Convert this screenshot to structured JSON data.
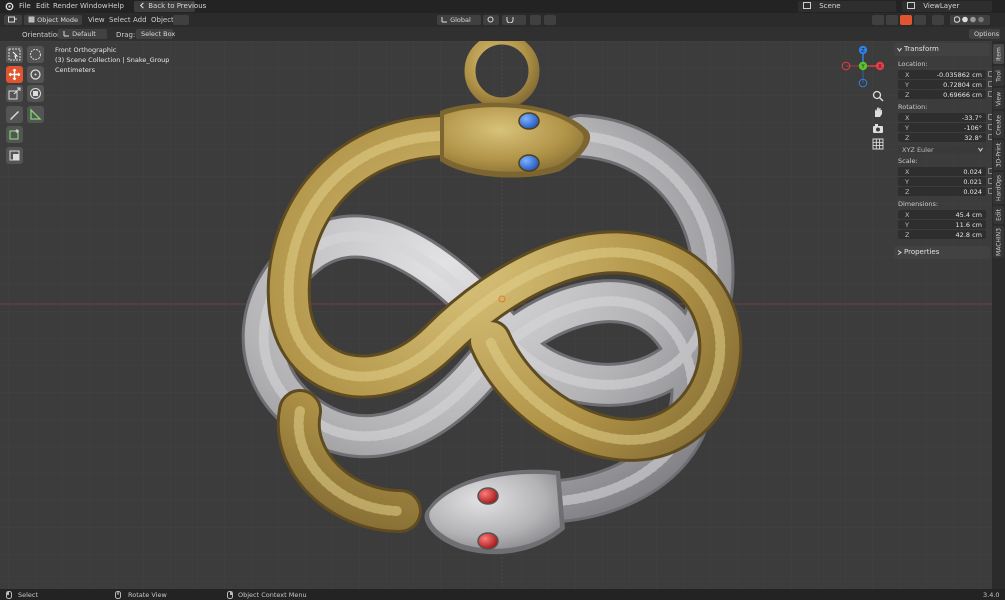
{
  "menu": {
    "file": "File",
    "edit": "Edit",
    "render": "Render",
    "window": "Window",
    "help": "Help",
    "back_button": "Back to Previous"
  },
  "scene": {
    "label": "Scene",
    "view_layer": "ViewLayer"
  },
  "header": {
    "mode": "Object Mode",
    "view": "View",
    "select": "Select",
    "add": "Add",
    "object": "Object",
    "transform_orientation": "Global",
    "options": "Options"
  },
  "tool_settings": {
    "orientation_label": "Orientation:",
    "orientation_value": "Default",
    "drag_label": "Drag:",
    "drag_value": "Select Box"
  },
  "viewport_info": {
    "view_name": "Front Orthographic",
    "collection": "(3) Scene Collection | Snake_Group",
    "units": "Centimeters"
  },
  "gizmo": {
    "x": "X",
    "y": "Y",
    "z": "Z"
  },
  "transform_panel": {
    "title": "Transform",
    "location_label": "Location:",
    "location": [
      {
        "axis": "X",
        "value": "-0.035862 cm"
      },
      {
        "axis": "Y",
        "value": "0.72804 cm"
      },
      {
        "axis": "Z",
        "value": "0.69666 cm"
      }
    ],
    "rotation_label": "Rotation:",
    "rotation": [
      {
        "axis": "X",
        "value": "-33.7°"
      },
      {
        "axis": "Y",
        "value": "-106°"
      },
      {
        "axis": "Z",
        "value": "32.8°"
      }
    ],
    "rotation_mode": "XYZ Euler",
    "scale_label": "Scale:",
    "scale": [
      {
        "axis": "X",
        "value": "0.024"
      },
      {
        "axis": "Y",
        "value": "0.021"
      },
      {
        "axis": "Z",
        "value": "0.024"
      }
    ],
    "dimensions_label": "Dimensions:",
    "dimensions": [
      {
        "axis": "X",
        "value": "45.4 cm"
      },
      {
        "axis": "Y",
        "value": "11.6 cm"
      },
      {
        "axis": "Z",
        "value": "42.8 cm"
      }
    ]
  },
  "properties_panel": {
    "title": "Properties"
  },
  "side_tabs": [
    "Item",
    "Tool",
    "View",
    "Create",
    "3D-Print",
    "HardOps",
    "Edit",
    "MACHIN3"
  ],
  "status_bar": {
    "select": "Select",
    "rotate_view": "Rotate View",
    "context_menu": "Object Context Menu",
    "version": "3.4.0"
  },
  "colors": {
    "accent": "#e0552f",
    "gold_snake": "#b39a4e",
    "silver_snake": "#b5b5b8",
    "blue_eye": "#2f6fd6",
    "red_eye": "#c42222",
    "x_axis": "#e33c4a",
    "y_axis": "#5ac22d",
    "z_axis": "#2f80e6"
  }
}
